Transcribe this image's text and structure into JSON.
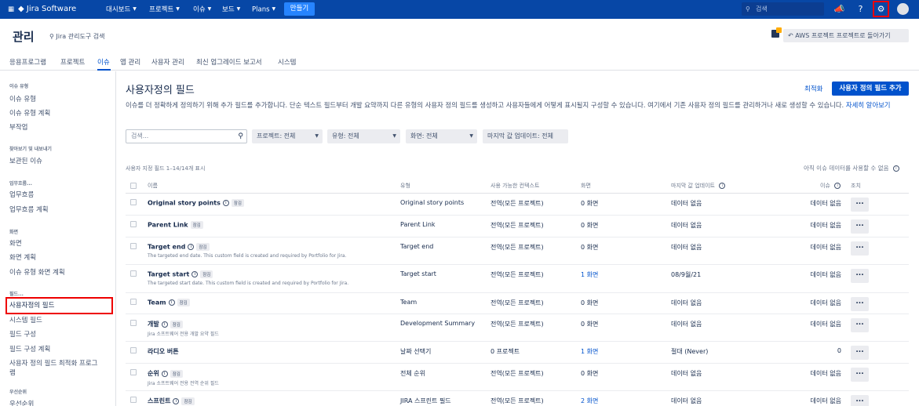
{
  "topnav": {
    "logo": "Jira Software",
    "items": [
      "대시보드",
      "프로젝트",
      "이슈",
      "보드",
      "Plans"
    ],
    "create": "만들기",
    "search_placeholder": "검색"
  },
  "header": {
    "title": "관리",
    "admin_search": "Jira 관리도구 검색",
    "aws_back": "AWS 프로젝트 프로젝트로 돌아가기"
  },
  "admin_tabs": [
    "응용프로그램",
    "프로젝트",
    "이슈",
    "앱 관리",
    "사용자 관리",
    "최신 업그레이드 보고서",
    "시스템"
  ],
  "sidebar": {
    "sections": [
      {
        "heading": "이슈 유형",
        "items": [
          "이슈 유형",
          "이슈 유형 계획",
          "부작업"
        ]
      },
      {
        "heading": "찾아보기 및 내보내기",
        "items": [
          "보관된 이슈"
        ]
      },
      {
        "heading": "업무흐름...",
        "items": [
          "업무흐름",
          "업무흐름 계획"
        ]
      },
      {
        "heading": "화면",
        "items": [
          "화면",
          "화면 계획",
          "이슈 유형 화면 계획"
        ]
      },
      {
        "heading": "필드...",
        "items": [
          "사용자정의 필드",
          "시스템 필드",
          "필드 구성",
          "필드 구성 계획",
          "사용자 정의 필드 최적화 프로그",
          "램"
        ]
      },
      {
        "heading": "우선순위",
        "items": [
          "우선순위"
        ]
      }
    ]
  },
  "main": {
    "title": "사용자정의 필드",
    "optimize": "최적화",
    "add_button": "사용자 정의 필드 추가",
    "description": "이슈를 더 정확하게 정의하기 위해 추가 필드를 추가합니다. 단순 텍스트 필드부터 개발 요약까지 다른 유형의 사용자 정의 필드를 생성하고 사용자들에게 어떻게 표시될지 구성할 수 있습니다. 여기에서 기존 사용자 정의 필드를 관리하거나 새로 생성할 수 있습니다.",
    "learn_more": "자세히 알아보기",
    "filters": {
      "search_placeholder": "검색...",
      "project": "프로젝트: 전체",
      "type": "유형: 전체",
      "screen": "화면: 전체",
      "last_value_update": "마지막 값 업데이트: 전체"
    },
    "count_text": "사용자 지정 필드 1–14/14개 표시",
    "no_data_note": "아직 이슈 데이터를 사용할 수 없음",
    "columns": [
      "이름",
      "유형",
      "사용 가능한 컨텍스트",
      "화면",
      "마지막 값 업데이트",
      "이슈",
      "조치"
    ],
    "rows": [
      {
        "name": "Original story points",
        "info": true,
        "locked": "잠김",
        "desc": "",
        "type": "Original story points",
        "context": "전역(모든 프로젝트)",
        "screens": "0 화면",
        "screens_link": false,
        "last_update": "데이터 없음",
        "issues": "데이터 없음"
      },
      {
        "name": "Parent Link",
        "info": false,
        "locked": "잠김",
        "desc": "",
        "type": "Parent Link",
        "context": "전역(모든 프로젝트)",
        "screens": "0 화면",
        "screens_link": false,
        "last_update": "데이터 없음",
        "issues": "데이터 없음"
      },
      {
        "name": "Target end",
        "info": true,
        "locked": "잠김",
        "desc": "The targeted end date. This custom field is created and required by Portfolio for Jira.",
        "type": "Target end",
        "context": "전역(모든 프로젝트)",
        "screens": "0 화면",
        "screens_link": false,
        "last_update": "데이터 없음",
        "issues": "데이터 없음"
      },
      {
        "name": "Target start",
        "info": true,
        "locked": "잠김",
        "desc": "The targeted start date. This custom field is created and required by Portfolio for Jira.",
        "type": "Target start",
        "context": "전역(모든 프로젝트)",
        "screens": "1 화면",
        "screens_link": true,
        "last_update": "08/9월/21",
        "issues": "데이터 없음"
      },
      {
        "name": "Team",
        "info": true,
        "locked": "잠김",
        "desc": "",
        "type": "Team",
        "context": "전역(모든 프로젝트)",
        "screens": "0 화면",
        "screens_link": false,
        "last_update": "데이터 없음",
        "issues": "데이터 없음"
      },
      {
        "name": "개발",
        "info": true,
        "locked": "잠김",
        "desc": "Jira 소프트웨어 전용 개발 요약 필드",
        "type": "Development Summary",
        "context": "전역(모든 프로젝트)",
        "screens": "0 화면",
        "screens_link": false,
        "last_update": "데이터 없음",
        "issues": "데이터 없음"
      },
      {
        "name": "라디오 버튼",
        "info": false,
        "locked": "",
        "desc": "",
        "type": "날짜 선택기",
        "context": "0 프로젝트",
        "screens": "1 화면",
        "screens_link": true,
        "last_update": "절대 (Never)",
        "issues": "0"
      },
      {
        "name": "순위",
        "info": true,
        "locked": "잠김",
        "desc": "Jira 소프트웨어 전용 전역 순위 필드",
        "type": "전체 순위",
        "context": "전역(모든 프로젝트)",
        "screens": "0 화면",
        "screens_link": false,
        "last_update": "데이터 없음",
        "issues": "데이터 없음"
      },
      {
        "name": "스프린트",
        "info": true,
        "locked": "잠김",
        "desc": "",
        "type": "JIRA 스프린트 필드",
        "context": "전역(모든 프로젝트)",
        "screens": "2 화면",
        "screens_link": true,
        "last_update": "데이터 없음",
        "issues": "데이터 없음"
      }
    ],
    "action_label": "..."
  }
}
